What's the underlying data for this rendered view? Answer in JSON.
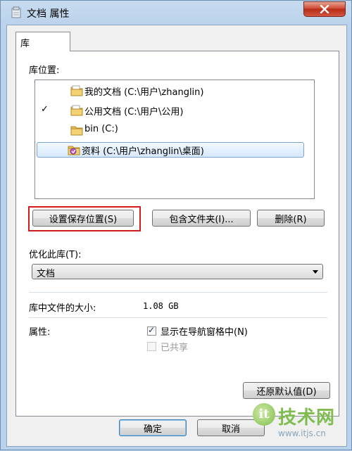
{
  "window": {
    "title": "文档 属性",
    "close_icon": "close-icon"
  },
  "tabs": [
    {
      "label": "库",
      "active": true
    }
  ],
  "library_locations": {
    "label": "库位置:",
    "items": [
      {
        "text": "我的文档 (C:\\用户\\zhanglin)",
        "icon": "folder-icon",
        "default_save": false,
        "selected": false
      },
      {
        "text": "公用文档 (C:\\用户\\公用)",
        "icon": "folder-icon",
        "default_save": true,
        "selected": false
      },
      {
        "text": "bin (C:)",
        "icon": "folder-icon",
        "default_save": false,
        "selected": false
      },
      {
        "text": "资料 (C:\\用户\\zhanglin\\桌面)",
        "icon": "special-folder-icon",
        "default_save": false,
        "selected": true
      }
    ],
    "check_glyph": "✓"
  },
  "buttons": {
    "set_save_location": "设置保存位置(S)",
    "include_folder": "包含文件夹(I)...",
    "remove": "删除(R)",
    "restore_defaults": "还原默认值(D)",
    "ok": "确定",
    "cancel": "取消"
  },
  "optimize": {
    "label": "优化此库(T):",
    "selected": "文档"
  },
  "size": {
    "label": "库中文件的大小:",
    "value": "1.08 GB"
  },
  "attributes": {
    "label": "属性:",
    "show_in_nav": {
      "label": "显示在导航窗格中(N)",
      "checked": true
    },
    "shared": {
      "label": "已共享",
      "checked": false,
      "disabled": true
    }
  },
  "watermark": {
    "badge": "it",
    "text": "技术网",
    "url": "www.itjs.cn"
  },
  "colors": {
    "highlight_box": "#d21c1c",
    "title_bar": "#b9d1ea",
    "selection": "#d6e8fb"
  }
}
